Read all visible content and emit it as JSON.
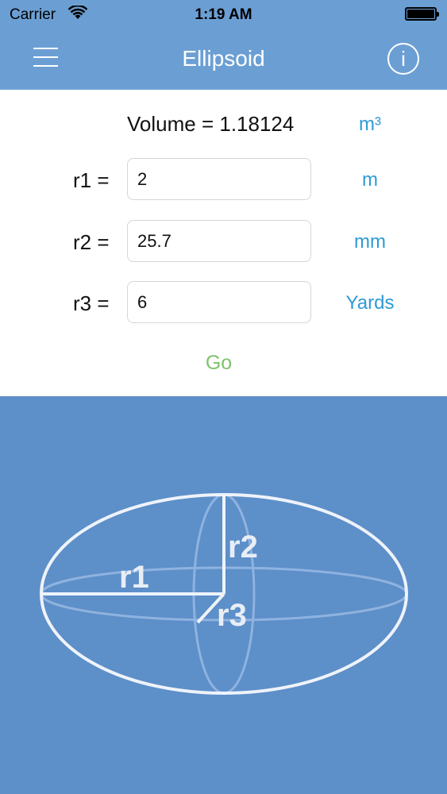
{
  "status_bar": {
    "carrier": "Carrier",
    "time": "1:19 AM"
  },
  "nav": {
    "title": "Ellipsoid",
    "menu_icon": "hamburger-menu-icon",
    "info_icon": "info-circle-icon",
    "info_glyph": "i"
  },
  "result": {
    "text": "Volume = 1.18124",
    "unit": "m³"
  },
  "inputs": [
    {
      "label": "r1 =",
      "value": "2",
      "unit": "m"
    },
    {
      "label": "r2 =",
      "value": "25.7",
      "unit": "mm"
    },
    {
      "label": "r3 =",
      "value": "6",
      "unit": "Yards"
    }
  ],
  "go_label": "Go",
  "diagram": {
    "labels": [
      "r1",
      "r2",
      "r3"
    ]
  },
  "colors": {
    "nav_bar": "#6b9fd4",
    "diagram_bg": "#5d8fc9",
    "unit_text": "#2e9ad6",
    "go_text": "#7ec26b"
  }
}
